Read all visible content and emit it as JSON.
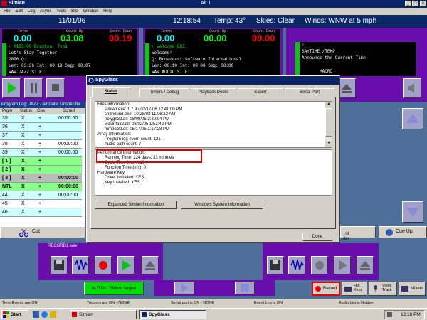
{
  "app": {
    "title": "Simian",
    "center_title": "Air 1"
  },
  "menu": [
    "File",
    "Edit",
    "Log",
    "Async",
    "Tools",
    "BSI",
    "Window",
    "Help"
  ],
  "clock": {
    "date": "11/01/06",
    "time": "12:18:54",
    "temp": "Temp: 43°",
    "skies": "Skies: Clear",
    "winds": "Winds: WNW at 5 mph"
  },
  "player1": {
    "intro_label": "Intro",
    "countup_label": "Count Up",
    "countdown_label": "Count Down",
    "intro": "0.00",
    "countup": "03.08",
    "countdown": "00.19",
    "line1": "+        0185-09  Braxton, Toni",
    "line2": "Let's Stay Together",
    "line3": "2006  Q:",
    "line4": "Len: 03:36  Int: 00:19     Seg: 00:07",
    "line5": "WAV   JAZZ    S:            E:"
  },
  "player2": {
    "intro_label": "Intro",
    "countup_label": "Count Up",
    "countdown_label": "Count Down",
    "intro": "0.00",
    "countup": "00.00",
    "countdown": "00.00",
    "line1": "+       welcome  BSI",
    "line2": "Welcome!",
    "line3": "Q: Broadcast Software International",
    "line4": "Len: 00:10  Int: 00:00     Seg: 00:00",
    "line5": "WAV   AUDIO    S:           E:"
  },
  "player3": {
    "line1": "+",
    "line2": "SAYTIME /TEMP",
    "line3": "Announce the Current Time",
    "line5": "MACRO"
  },
  "log": {
    "header": "Program Log: JAZZ -   Air Date: Unspecifie",
    "cols": [
      "Prgm",
      "Status",
      "Cue",
      "Sched"
    ],
    "rows": [
      [
        "35",
        "X",
        "+",
        "00:00:00"
      ],
      [
        "36",
        "X",
        "+",
        ""
      ],
      [
        "37",
        "X",
        "+",
        ""
      ],
      [
        "38",
        "X",
        "+",
        "00:00:00"
      ],
      [
        "39",
        "X",
        "+",
        "00:00:00"
      ],
      [
        "[ 1 ]",
        "X",
        "+",
        ""
      ],
      [
        "[ 2 ]",
        "X",
        "+",
        ""
      ],
      [
        "[ 3 ]",
        "X",
        "+",
        "00:00:00"
      ],
      [
        "NTL",
        "X",
        "+",
        "00:00:00"
      ],
      [
        "44",
        "X",
        "+",
        "00:00:00"
      ],
      [
        "45",
        "X",
        "+",
        ""
      ],
      [
        "46",
        "X",
        "+",
        ""
      ]
    ],
    "cut": "Cut"
  },
  "dialog": {
    "title": "SpyGlass",
    "tabs": [
      "Status",
      "Timers / Debug",
      "Playback Decks",
      "Expert",
      "Serial Port"
    ],
    "files_lines": [
      "Files information:",
      "      simian.exe: 1.7.9 / 02/17/06 12:41:00 PM",
      "      sndhound.exe: 10/28/03 11:06:22 AM",
      "      holygrl32.dll: 08/09/05 3:30:04 PM",
      "      wavinfo32.dll: 08/02/05 1:52:42 PM",
      "      mmbsi32.dll: 05/17/05 1:17:28 PM",
      "Array information:",
      "      Program log event count: 121",
      "      Audio path count: 7"
    ],
    "perf_lines": [
      "Performance information:",
      "      Running Time: 224 days, 33 minutes",
      "      Cycle Time (ms): 110",
      "      Function Time (ms): 0",
      "Hardware Key",
      "      Driver Installed: YES",
      "      Key Installed: YES"
    ],
    "btn_expanded": "Expanded Simian Information",
    "btn_windows": "Windows System Information",
    "btn_done": "Done"
  },
  "right": {
    "cue_up": "Cue Up",
    "order": "nt\nder"
  },
  "record": {
    "title": "RECORD1.wav",
    "auto": "AUTO - 750ms segue",
    "record_btn": "Record",
    "hotkeys": "Hot Keys",
    "voicetrack": "Voice Track",
    "mixers": "Mixers"
  },
  "status": [
    "Time Events are ON",
    "Triggers are ON - NONE",
    "Serial port is ON - NONE",
    "Event Log is ON",
    "Audio List is Hidden"
  ],
  "taskbar": {
    "start": "Start",
    "task1": "Simian",
    "task2": "SpyGlass",
    "time": "12:18 PM"
  },
  "colors": {
    "player_purple": "#6a0dad",
    "display_green": "#00ff00",
    "countdown_red": "#ff0000",
    "highlight_red": "#e00000",
    "titlebar_blue": "#0a246a"
  }
}
